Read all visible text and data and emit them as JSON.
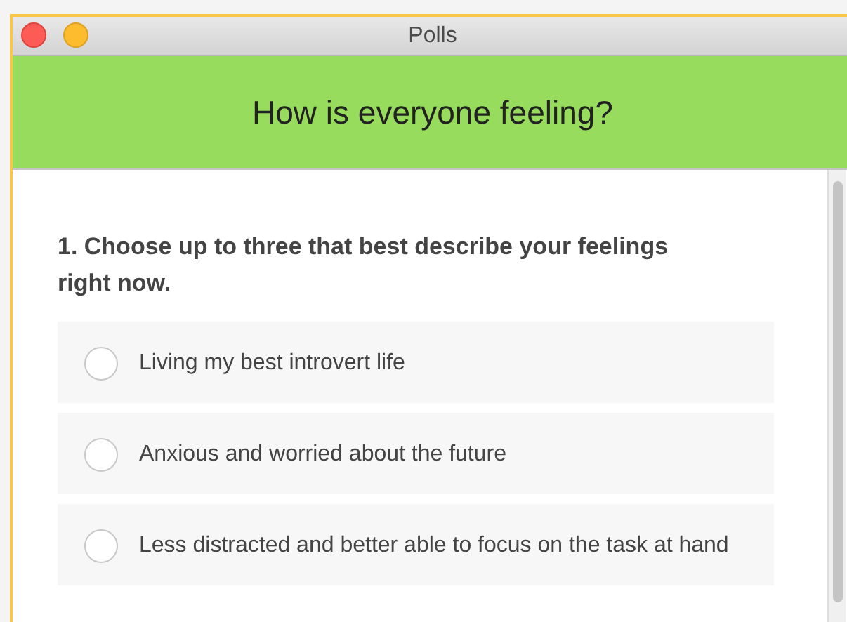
{
  "window": {
    "title": "Polls"
  },
  "header": {
    "title": "How is everyone feeling?"
  },
  "question": {
    "text": "1. Choose up to three that best describe your feelings right now.",
    "options": [
      {
        "label": "Living my best introvert life",
        "selected": false
      },
      {
        "label": "Anxious and worried about the future",
        "selected": false
      },
      {
        "label": "Less distracted and better able to focus on the task at hand",
        "selected": false
      }
    ]
  }
}
